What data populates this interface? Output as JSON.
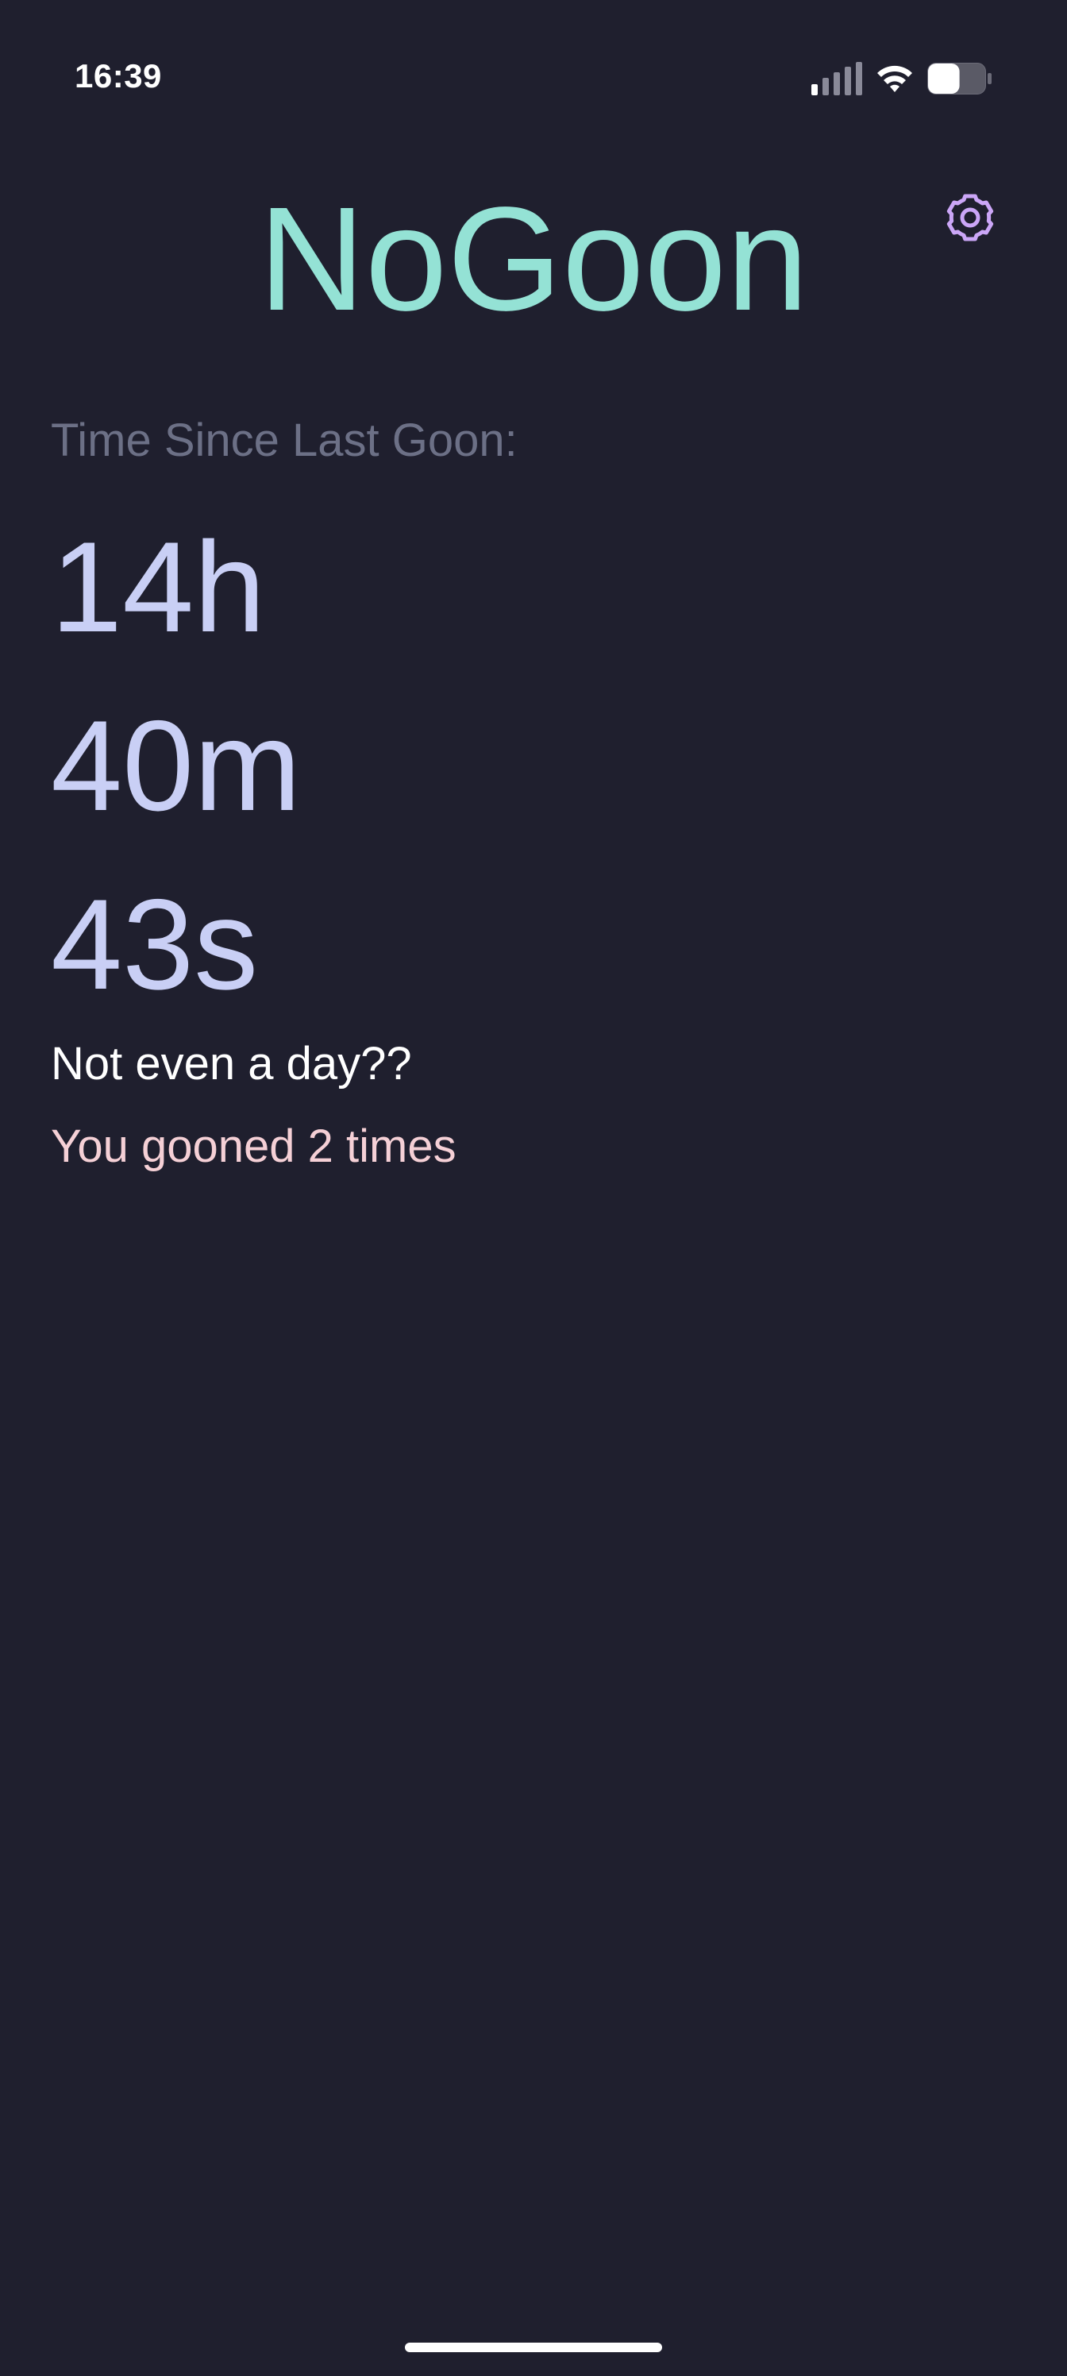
{
  "status_bar": {
    "time": "16:39",
    "signal_icon": "cellular-signal-icon",
    "wifi_icon": "wifi-icon",
    "battery_icon": "battery-icon",
    "battery_level": 0.55
  },
  "header": {
    "title": "NoGoon",
    "settings_icon": "gear-icon"
  },
  "timer": {
    "label": "Time Since Last Goon:",
    "hours": "14h",
    "minutes": "40m",
    "seconds": "43s"
  },
  "message": "Not even a day??",
  "count_text": "You gooned 2 times",
  "colors": {
    "background": "#1f1f2e",
    "title": "#94e2d5",
    "accent_icon": "#cba6f7",
    "timer": "#c9cff5",
    "label": "#6c7086",
    "count": "#f5d0d6"
  }
}
